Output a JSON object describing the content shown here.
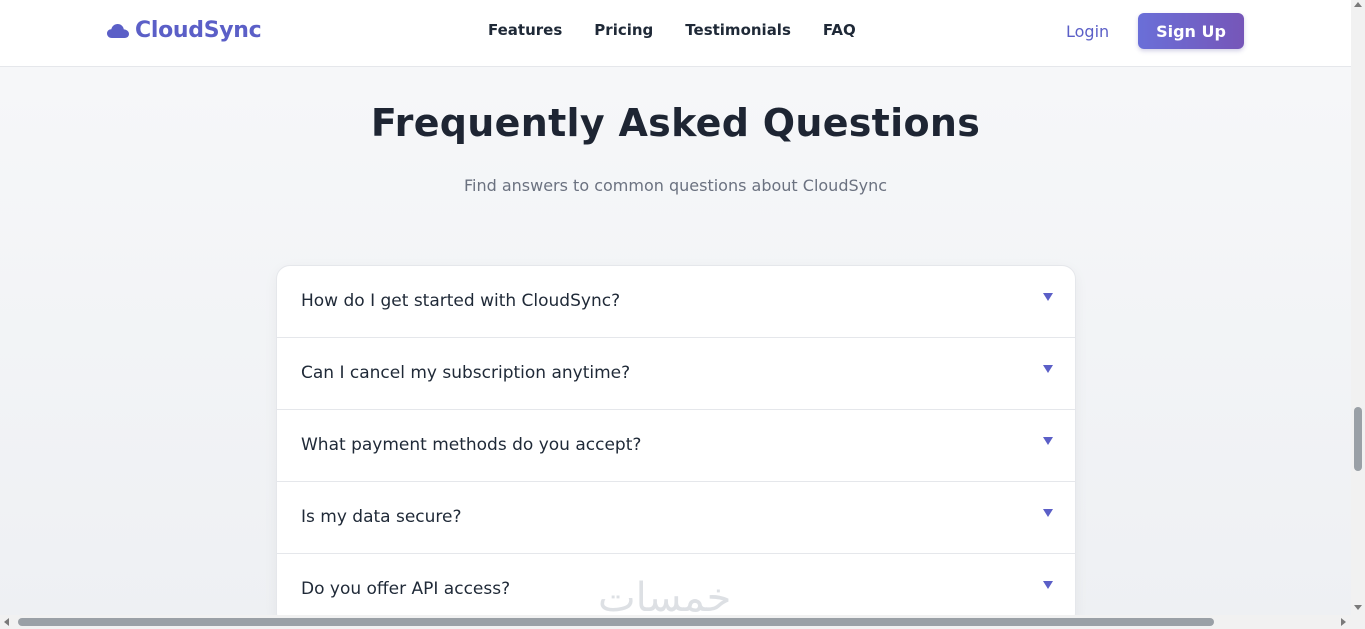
{
  "header": {
    "brand": "CloudSync",
    "brand_icon": "cloud-icon",
    "nav": [
      "Features",
      "Pricing",
      "Testimonials",
      "FAQ"
    ],
    "login_label": "Login",
    "signup_label": "Sign Up"
  },
  "faq": {
    "title": "Frequently Asked Questions",
    "subtitle": "Find answers to common questions about CloudSync",
    "questions": [
      "How do I get started with CloudSync?",
      "Can I cancel my subscription anytime?",
      "What payment methods do you accept?",
      "Is my data secure?",
      "Do you offer API access?"
    ]
  },
  "colors": {
    "accent": "#5b5fc7",
    "button_gradient_start": "#6a6fd8",
    "button_gradient_end": "#7656b8",
    "heading": "#1e2533"
  }
}
